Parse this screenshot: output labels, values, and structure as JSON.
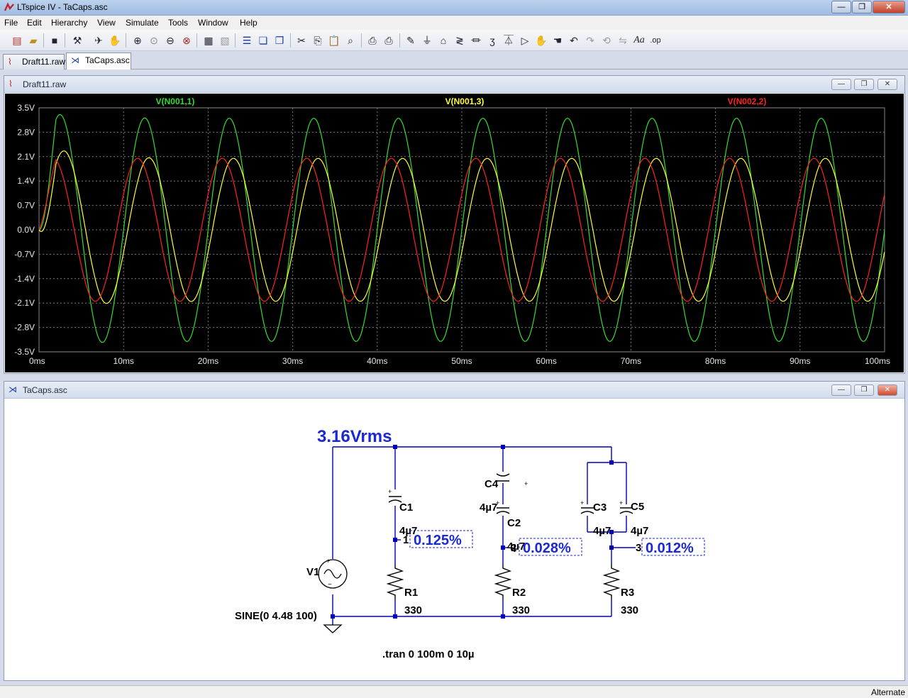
{
  "app": {
    "title": "LTspice IV - TaCaps.asc"
  },
  "menu": [
    "File",
    "Edit",
    "Hierarchy",
    "View",
    "Simulate",
    "Tools",
    "Window",
    "Help"
  ],
  "tabs": [
    {
      "label": "Draft11.raw",
      "icon": "waveform-icon",
      "active": false
    },
    {
      "label": "TaCaps.asc",
      "icon": "schematic-icon",
      "active": true
    }
  ],
  "toolbar": {
    "icons": [
      "new-schematic-icon",
      "open-icon",
      "save-icon",
      "control-panel-icon",
      "run-icon",
      "halt-icon",
      "zoom-in-icon",
      "zoom-pan-icon",
      "zoom-out-icon",
      "zoom-cancel-icon",
      "autorange-icon",
      "edit-plot-icon",
      "tile-horizontal-icon",
      "cascade-icon",
      "close-all-icon",
      "cut-icon",
      "copy-icon",
      "paste-icon",
      "find-icon",
      "print-icon",
      "print-preview-icon",
      "draw-wire-icon",
      "ground-icon",
      "label-net-icon",
      "resistor-icon",
      "capacitor-icon",
      "inductor-icon",
      "diode-icon",
      "component-icon",
      "move-icon",
      "drag-icon",
      "undo-icon",
      "redo-icon",
      "rotate-icon",
      "mirror-icon",
      "text-icon",
      "spice-directive-icon"
    ]
  },
  "plot_window": {
    "title": "Draft11.raw"
  },
  "chart_data": {
    "type": "line",
    "xlabel": "",
    "ylabel": "",
    "xlim": [
      0,
      100
    ],
    "ylim": [
      -3.5,
      3.5
    ],
    "x_ticks": [
      "0ms",
      "10ms",
      "20ms",
      "30ms",
      "40ms",
      "50ms",
      "60ms",
      "70ms",
      "80ms",
      "90ms",
      "100ms"
    ],
    "y_ticks": [
      "3.5V",
      "2.8V",
      "2.1V",
      "1.4V",
      "0.7V",
      "0.0V",
      "-0.7V",
      "-1.4V",
      "-2.1V",
      "-2.8V",
      "-3.5V"
    ],
    "grid": true,
    "background": "#000000",
    "series": [
      {
        "name": "V(N001,1)",
        "color": "#33dd33",
        "frequency_hz": 100,
        "amplitude_v": 3.2,
        "initial_peak_v": 3.4
      },
      {
        "name": "V(N001,3)",
        "color": "#ffff33",
        "frequency_hz": 100,
        "amplitude_v": 2.05,
        "initial_peak_v": 2.5
      },
      {
        "name": "V(N002,2)",
        "color": "#ff2222",
        "frequency_hz": 100,
        "amplitude_v": 2.05,
        "initial_peak_v": 2.05
      }
    ]
  },
  "schematic_window": {
    "title": "TaCaps.asc"
  },
  "schematic": {
    "source_label": "3.16Vrms",
    "source_name": "V1",
    "source_value": "SINE(0 4.48 100)",
    "directive": ".tran 0 100m 0 10µ",
    "components": [
      {
        "ref": "C1",
        "value": "4µ7"
      },
      {
        "ref": "C2",
        "value": "4µ7"
      },
      {
        "ref": "C3",
        "value": "4µ7"
      },
      {
        "ref": "C4",
        "value": "4µ7"
      },
      {
        "ref": "C5",
        "value": "4µ7"
      },
      {
        "ref": "R1",
        "value": "330"
      },
      {
        "ref": "R2",
        "value": "330"
      },
      {
        "ref": "R3",
        "value": "330"
      }
    ],
    "nodes": [
      {
        "label": "1",
        "value": "0.125%"
      },
      {
        "label": "2",
        "value": "0.028%"
      },
      {
        "label": "3",
        "value": "0.012%"
      }
    ],
    "wire_color": "#0000bb",
    "label_color": "#1a2ad0"
  },
  "status": {
    "text": "Alternate"
  }
}
